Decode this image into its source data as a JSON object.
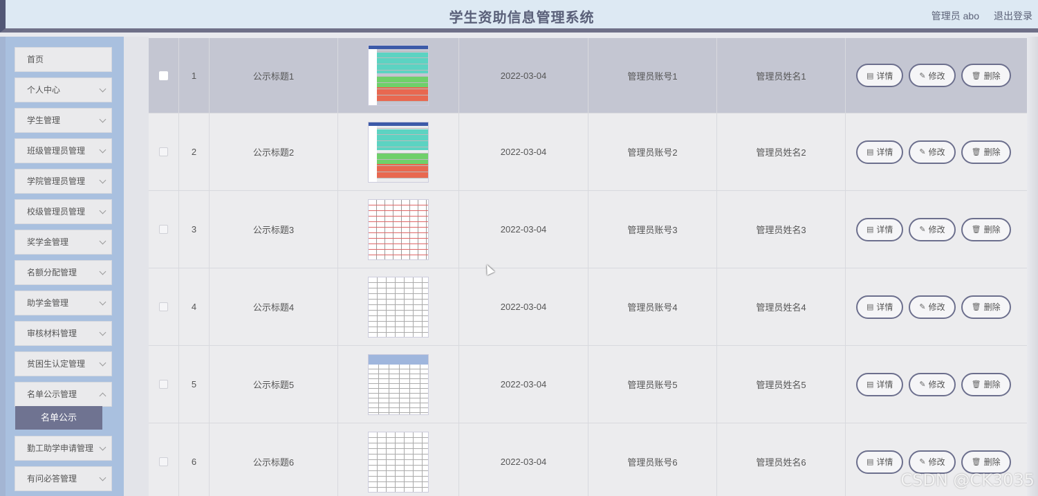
{
  "header": {
    "title": "学生资助信息管理系统",
    "user": "管理员 abo",
    "logout": "退出登录"
  },
  "sidebar": {
    "items": [
      {
        "label": "首页"
      },
      {
        "label": "个人中心"
      },
      {
        "label": "学生管理"
      },
      {
        "label": "班级管理员管理"
      },
      {
        "label": "学院管理员管理"
      },
      {
        "label": "校级管理员管理"
      },
      {
        "label": "奖学金管理"
      },
      {
        "label": "名额分配管理"
      },
      {
        "label": "助学金管理"
      },
      {
        "label": "审核材料管理"
      },
      {
        "label": "贫困生认定管理"
      },
      {
        "label": "名单公示管理"
      },
      {
        "label": "勤工助学申请管理"
      },
      {
        "label": "有问必答管理"
      }
    ],
    "active_sub": "名单公示"
  },
  "actions": {
    "detail": "详情",
    "edit": "修改",
    "delete": "删除"
  },
  "rows": [
    {
      "index": "1",
      "title": "公示标题1",
      "date": "2022-03-04",
      "account": "管理员账号1",
      "name": "管理员姓名1"
    },
    {
      "index": "2",
      "title": "公示标题2",
      "date": "2022-03-04",
      "account": "管理员账号2",
      "name": "管理员姓名2"
    },
    {
      "index": "3",
      "title": "公示标题3",
      "date": "2022-03-04",
      "account": "管理员账号3",
      "name": "管理员姓名3"
    },
    {
      "index": "4",
      "title": "公示标题4",
      "date": "2022-03-04",
      "account": "管理员账号4",
      "name": "管理员姓名4"
    },
    {
      "index": "5",
      "title": "公示标题5",
      "date": "2022-03-04",
      "account": "管理员账号5",
      "name": "管理员姓名5"
    },
    {
      "index": "6",
      "title": "公示标题6",
      "date": "2022-03-04",
      "account": "管理员账号6",
      "name": "管理员姓名6"
    }
  ],
  "watermark": "CSDN @CK3035"
}
